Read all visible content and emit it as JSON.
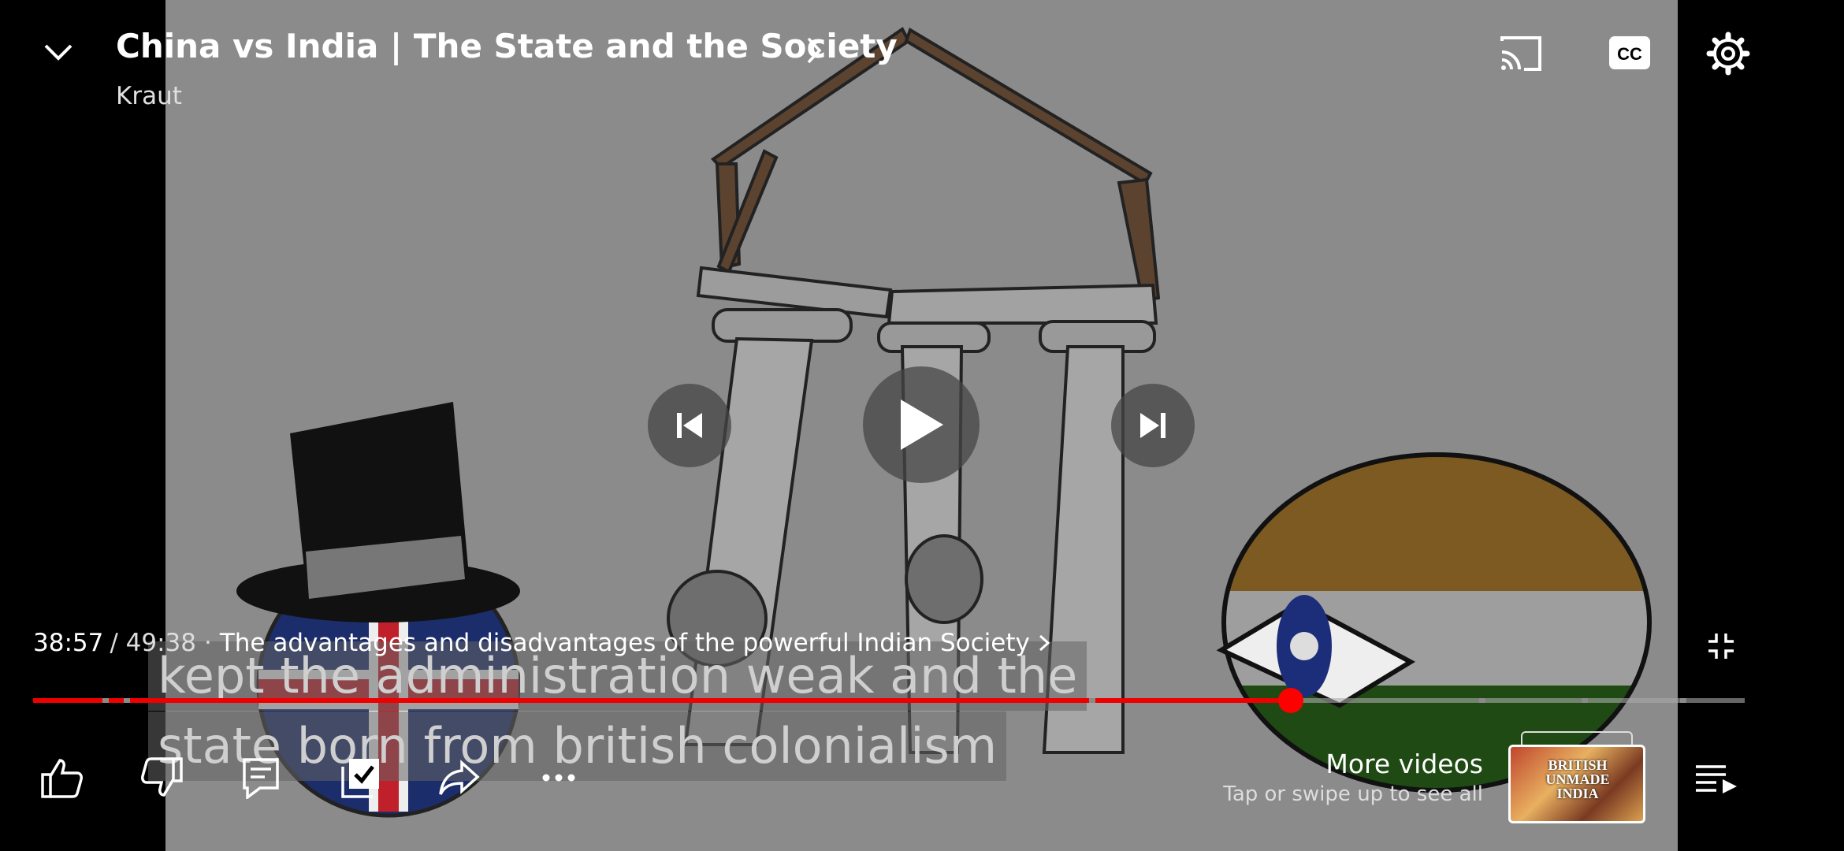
{
  "video": {
    "title": "China vs India | The State and the Society",
    "channel": "Kraut",
    "current_time": "38:57",
    "duration": "/ 49:38",
    "chapter_separator": "·",
    "chapter_title": "The advantages and disadvantages of the powerful Indian Society",
    "progress_fraction": 0.735,
    "captions": [
      "kept the administration weak and the",
      "state born from british colonialism"
    ]
  },
  "controls": {
    "cast_icon": "cast-icon",
    "cc_icon": "closed-captions-icon",
    "settings_icon": "gear-icon",
    "minimize_icon": "chevron-down-icon",
    "exit_fullscreen_icon": "exit-fullscreen-icon"
  },
  "actions": {
    "like": "thumbs-up-icon",
    "dislike": "thumbs-down-icon",
    "comments": "comment-icon",
    "save": "save-to-playlist-icon",
    "share": "share-icon",
    "more": "more-dots-icon",
    "queue": "queue-icon"
  },
  "more_videos": {
    "title": "More videos",
    "subtitle": "Tap or swipe up to see all",
    "thumbnail_text": "BRITISH UNMADE INDIA"
  },
  "colors": {
    "progress_played": "#ee0000",
    "progress_unplayed": "#aaaaaa",
    "background": "#000000"
  }
}
